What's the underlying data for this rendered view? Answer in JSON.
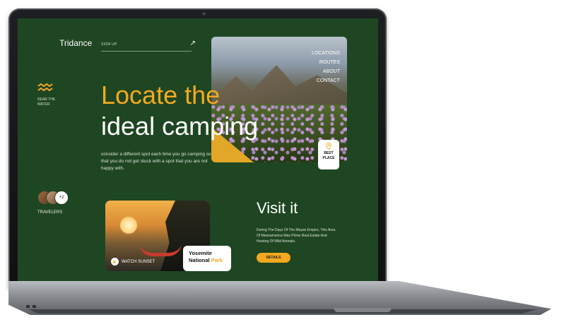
{
  "device": {
    "model_label": "MacBook Pro"
  },
  "header": {
    "brand": "Tridance",
    "signup_label": "SIGN UP"
  },
  "nav": {
    "items": [
      "LOCATIONS",
      "ROUTES",
      "ABOUT",
      "CONTACT"
    ]
  },
  "hero": {
    "headline_line1": "Locate the",
    "headline_line2": "ideal camping",
    "description": "consider a different spot each time you go camping so that you do not get stuck with a spot that you are not happy with.",
    "near_water": "NEAR THE WATER",
    "best_place_line1": "BEST",
    "best_place_line2": "PLACE"
  },
  "travelers": {
    "extra_count": "+2",
    "label": "TRAVELERS"
  },
  "card": {
    "watch_label": "WATCH SUNSET",
    "location_line1": "Yosemite",
    "location_line2a": "National",
    "location_line2b": "Park"
  },
  "visit": {
    "title": "Visit it",
    "description": "During The Days Of The Mayan Empire, This Area Of Mesoamerica Was Prime Real Estate And Hunting Of Wild Animals.",
    "details_label": "DETAILS"
  },
  "colors": {
    "background": "#1f4622",
    "accent": "#f3a91f",
    "text": "#ffffff"
  },
  "icons": [
    "arrow-up-right-icon",
    "waves-icon",
    "location-pin-icon",
    "play-icon"
  ]
}
